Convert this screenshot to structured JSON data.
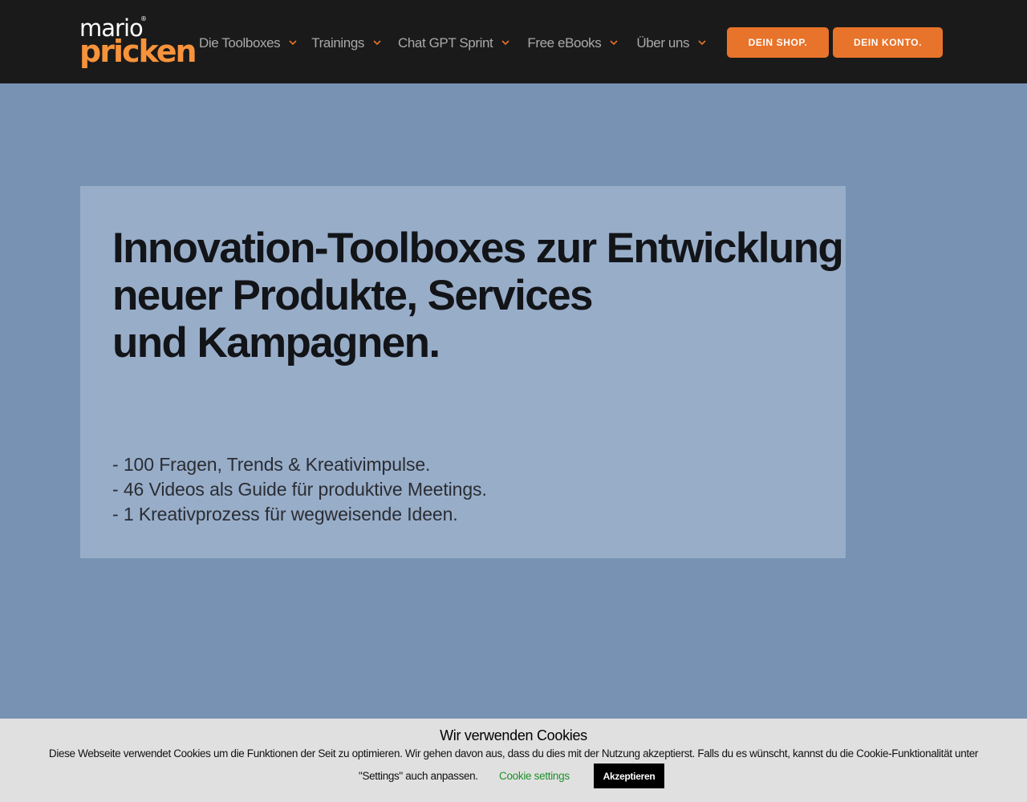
{
  "brand": {
    "logo_top": "mario",
    "logo_reg": "®",
    "logo_bottom": "pricken",
    "accent_color": "#e8732a",
    "logo_color": "#f7933b"
  },
  "nav": {
    "items": [
      {
        "label": "Die Toolboxes",
        "icon": "chevron-down-icon"
      },
      {
        "label": "Trainings",
        "icon": "chevron-down-icon"
      },
      {
        "label": "Chat GPT Sprint",
        "icon": "chevron-down-icon"
      },
      {
        "label": "Free eBooks",
        "icon": "chevron-down-icon"
      },
      {
        "label": "Über uns",
        "icon": "chevron-down-icon"
      }
    ],
    "shop_label": "DEIN SHOP.",
    "konto_label": "DEIN KONTO."
  },
  "hero": {
    "title_lines": [
      "Innovation-Toolboxes zur Entwicklung",
      "neuer Produkte, Services",
      "und Kampagnen."
    ],
    "bullets": [
      "- 100 Fragen, Trends & Kreativimpulse.",
      "- 46 Videos als Guide für produktive Meetings.",
      "- 1 Kreativprozess für wegweisende Ideen."
    ],
    "background_color": "#7792b2",
    "card_color": "#98adc8"
  },
  "cookie": {
    "title": "Wir verwenden Cookies",
    "text_line1": "Diese Webseite verwendet Cookies um die Funktionen der Seit zu optimieren. Wir gehen davon aus, dass du dies mit der Nutzung akzeptierst. Falls du es wünscht, kannst du die Cookie-Funktionalität unter",
    "text_line2": "\"Settings\" auch anpassen.",
    "settings_label": "Cookie settings",
    "accept_label": "Akzeptieren",
    "link_color": "#1f8f2c"
  }
}
